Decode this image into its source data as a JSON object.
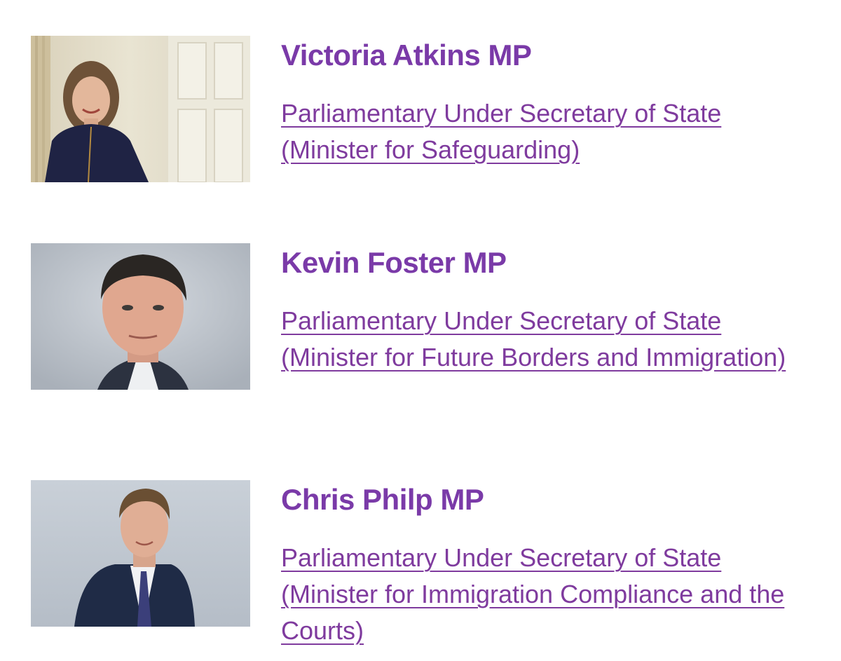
{
  "colors": {
    "link": "#7f3b9e",
    "name": "#7a3aa8",
    "background": "#ffffff"
  },
  "ministers": [
    {
      "name": "Victoria Atkins MP",
      "role": "Parliamentary Under Secretary of State (Minister for Safeguarding)"
    },
    {
      "name": "Kevin Foster MP",
      "role": "Parliamentary Under Secretary of State (Minister for Future Borders and Immigration)"
    },
    {
      "name": "Chris Philp MP",
      "role": "Parliamentary Under Secretary of State (Minister for Immigration Compliance and the Courts)"
    }
  ]
}
